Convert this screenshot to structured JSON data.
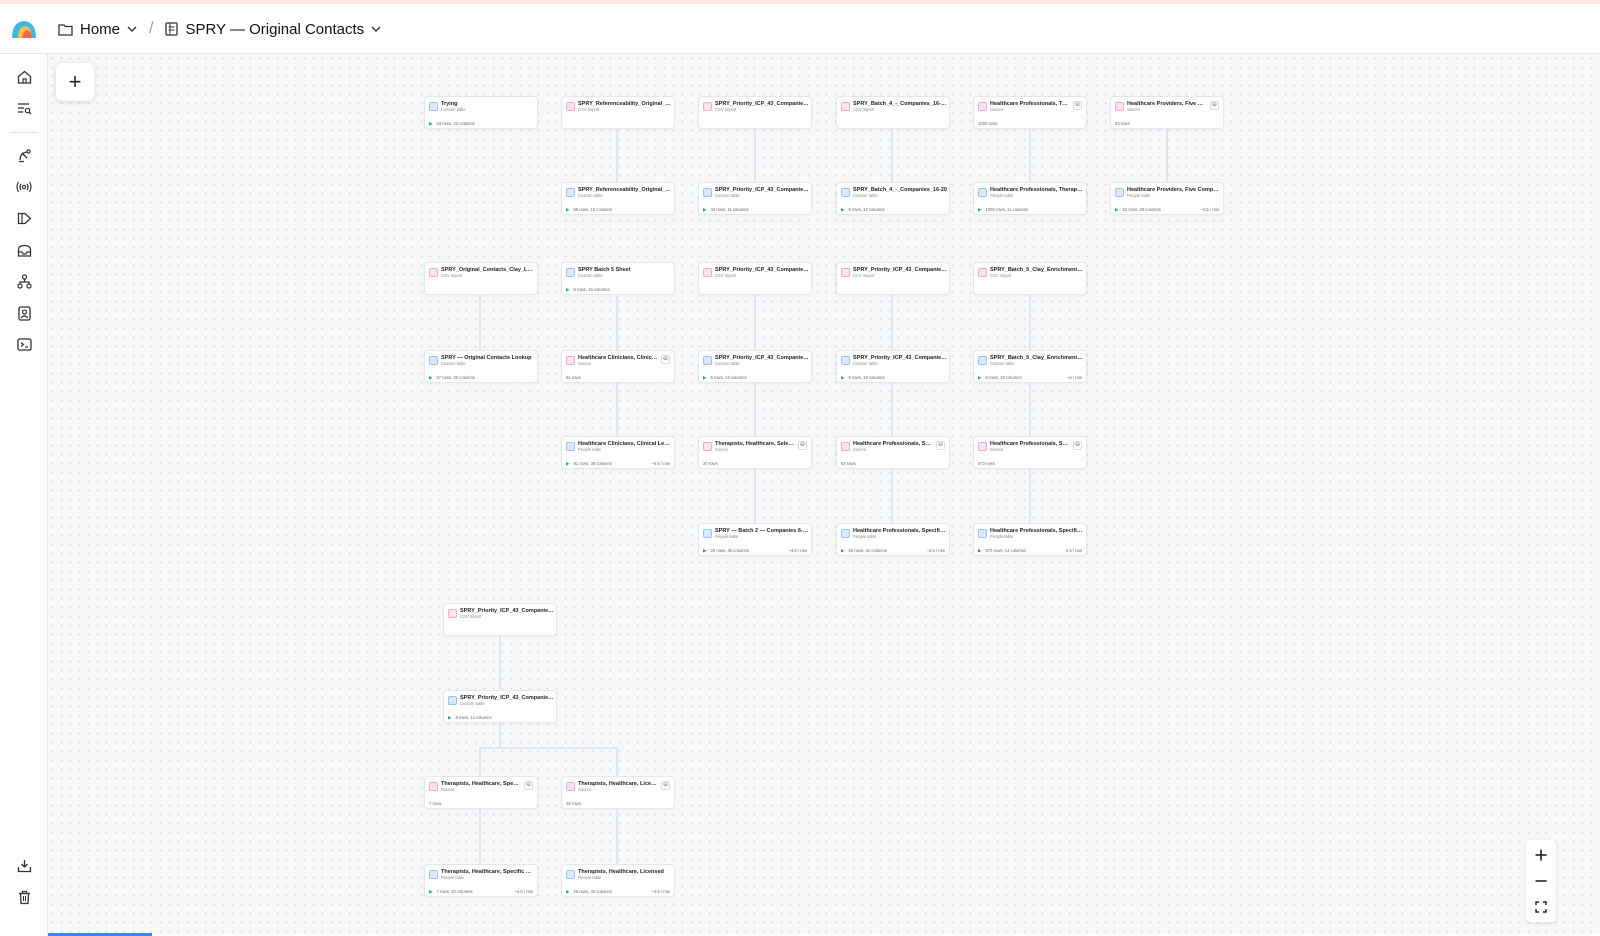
{
  "breadcrumb": {
    "home_label": "Home",
    "doc_label": "SPRY — Original Contacts"
  },
  "sidebar": {
    "items": [
      {
        "icon": "home-icon"
      },
      {
        "icon": "search-list-icon"
      },
      {
        "icon": "satellite-icon"
      },
      {
        "icon": "broadcast-icon"
      },
      {
        "icon": "megaphone-icon"
      },
      {
        "icon": "inbox-icon"
      },
      {
        "icon": "workflow-icon"
      },
      {
        "icon": "contact-card-icon"
      },
      {
        "icon": "terminal-icon"
      }
    ],
    "bottom": [
      {
        "icon": "import-icon"
      },
      {
        "icon": "trash-icon"
      }
    ]
  },
  "canvas": {
    "add_label": "+",
    "nodes": [
      {
        "title": "Trying",
        "sub": "Custom table",
        "stat": "44 rows, 22 columns",
        "rate": "",
        "kind": "ct",
        "db": false
      },
      {
        "title": "SPRY_Referenceability_Original_Cont...",
        "sub": "CSV import",
        "stat": "",
        "rate": "",
        "kind": "csv",
        "db": false
      },
      {
        "title": "SPRY_Priority_ICP_43_Companies (2) ...",
        "sub": "CSV import",
        "stat": "",
        "rate": "",
        "kind": "csv",
        "db": false
      },
      {
        "title": "SPRY_Batch_4_-_Companies_16-20.csv",
        "sub": "CSV import",
        "stat": "",
        "rate": "",
        "kind": "csv",
        "db": false
      },
      {
        "title": "Healthcare Professionals, Ther...",
        "sub": "Source",
        "stat": "1000 rows",
        "rate": "",
        "kind": "src",
        "db": true
      },
      {
        "title": "Healthcare Providers, Five Com...",
        "sub": "Source",
        "stat": "62 rows",
        "rate": "",
        "kind": "src",
        "db": true
      },
      {
        "title": "SPRY_Referenceability_Original_Cont...",
        "sub": "Custom table",
        "stat": "95 rows, 15 columns",
        "rate": "",
        "kind": "ct",
        "db": false
      },
      {
        "title": "SPRY_Priority_ICP_43_Companies (2)",
        "sub": "Custom table",
        "stat": "43 rows, 11 columns",
        "rate": "",
        "kind": "ct",
        "db": false
      },
      {
        "title": "SPRY_Batch_4_-_Companies_16-20",
        "sub": "Custom table",
        "stat": "5 rows, 17 columns",
        "rate": "",
        "kind": "ct",
        "db": false
      },
      {
        "title": "Healthcare Professionals, Therapy, C...",
        "sub": "People table",
        "stat": "1000 rows, 11 columns",
        "rate": "",
        "kind": "ht",
        "db": false
      },
      {
        "title": "Healthcare Providers, Five Companies",
        "sub": "People table",
        "stat": "62 rows, 28 columns",
        "rate": "~4.5 / row",
        "kind": "ht",
        "db": false
      },
      {
        "title": "SPRY_Original_Contacts_Clay_Lookup...",
        "sub": "CSV import",
        "stat": "",
        "rate": "",
        "kind": "csv",
        "db": false
      },
      {
        "title": "SPRY Batch 5 Sheet",
        "sub": "Custom table",
        "stat": "8 rows, 15 columns",
        "rate": "",
        "kind": "ct",
        "db": false
      },
      {
        "title": "SPRY_Priority_ICP_43_Companies (3)...",
        "sub": "CSV import",
        "stat": "",
        "rate": "",
        "kind": "csv",
        "db": false
      },
      {
        "title": "SPRY_Priority_ICP_43_Companies 4 - ...",
        "sub": "CSV import",
        "stat": "",
        "rate": "",
        "kind": "csv",
        "db": false
      },
      {
        "title": "SPRY_Batch_5_Clay_Enrichment_Rea...",
        "sub": "CSV import",
        "stat": "",
        "rate": "",
        "kind": "csv",
        "db": false
      },
      {
        "title": "SPRY — Original Contacts Lookup",
        "sub": "Custom table",
        "stat": "57 rows, 20 columns",
        "rate": "",
        "kind": "ct",
        "db": false
      },
      {
        "title": "Healthcare Clinicians, Clinical L...",
        "sub": "Source",
        "stat": "81 rows",
        "rate": "",
        "kind": "src",
        "db": true
      },
      {
        "title": "SPRY_Priority_ICP_43_Companies (3)...",
        "sub": "Custom table",
        "stat": "6 rows, 13 columns",
        "rate": "",
        "kind": "ct",
        "db": false
      },
      {
        "title": "SPRY_Priority_ICP_43_Companies 4 - ...",
        "sub": "Custom table",
        "stat": "5 rows, 18 columns",
        "rate": "",
        "kind": "ct",
        "db": false
      },
      {
        "title": "SPRY_Batch_5_Clay_Enrichment_Ready",
        "sub": "Custom table",
        "stat": "5 rows, 19 columns",
        "rate": "~4 / row",
        "kind": "ct",
        "db": false
      },
      {
        "title": "Healthcare Clinicians, Clinical Leader...",
        "sub": "People table",
        "stat": "81 rows, 38 columns",
        "rate": "~4.5 / row",
        "kind": "ht",
        "db": false
      },
      {
        "title": "Therapists, Healthcare, Selecte...",
        "sub": "Source",
        "stat": "20 rows",
        "rate": "",
        "kind": "src",
        "db": true
      },
      {
        "title": "Healthcare Professionals, Spec...",
        "sub": "Source",
        "stat": "53 rows",
        "rate": "",
        "kind": "src",
        "db": true
      },
      {
        "title": "Healthcare Professionals, Spec...",
        "sub": "Source",
        "stat": "873 rows",
        "rate": "",
        "kind": "src",
        "db": true
      },
      {
        "title": "SPRY — Batch 2 — Companies 6-10 ...",
        "sub": "People table",
        "stat": "20 rows, 40 columns",
        "rate": "~4.5 / row",
        "kind": "ht",
        "db": false
      },
      {
        "title": "Healthcare Professionals, Specific Co...",
        "sub": "People table",
        "stat": "53 rows, 42 columns",
        "rate": "~4.5 / row",
        "kind": "ht",
        "db": false
      },
      {
        "title": "Healthcare Professionals, Specific Co...",
        "sub": "People table",
        "stat": "873 rows, 14 columns",
        "rate": "0.5 / row",
        "kind": "ht",
        "db": false
      },
      {
        "title": "SPRY_Priority_ICP_43_Companies (2)...",
        "sub": "CSV import",
        "stat": "",
        "rate": "",
        "kind": "csv",
        "db": false
      },
      {
        "title": "SPRY_Priority_ICP_43_Companies (2) ...",
        "sub": "Custom table",
        "stat": "8 rows, 14 columns",
        "rate": "",
        "kind": "ct",
        "db": false
      },
      {
        "title": "Therapists, Healthcare, Specifi...",
        "sub": "Source",
        "stat": "7 rows",
        "rate": "",
        "kind": "src",
        "db": true
      },
      {
        "title": "Therapists, Healthcare, Licensed",
        "sub": "Source",
        "stat": "26 rows",
        "rate": "",
        "kind": "src",
        "db": true
      },
      {
        "title": "Therapists, Healthcare, Specific Com...",
        "sub": "People table",
        "stat": "7 rows, 40 columns",
        "rate": "~4.5 / row",
        "kind": "ht",
        "db": false
      },
      {
        "title": "Therapists, Healthcare, Licensed",
        "sub": "People table",
        "stat": "26 rows, 40 columns",
        "rate": "~4.5 / row",
        "kind": "ht",
        "db": false
      }
    ]
  },
  "zoom": {
    "in_label": "+",
    "out_label": "—"
  },
  "colors": {
    "accent": "#3b82f6",
    "play": "#22a55a"
  }
}
